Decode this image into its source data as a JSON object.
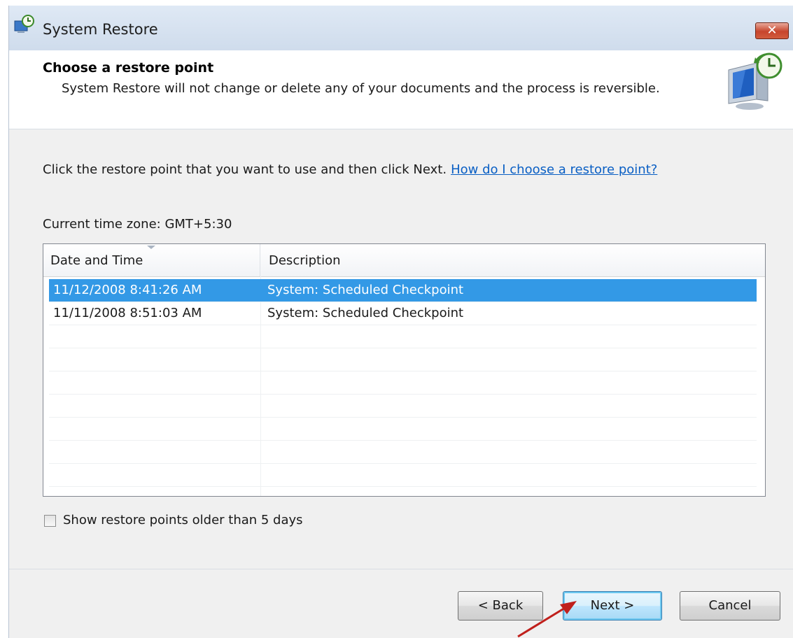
{
  "window": {
    "title": "System Restore",
    "close_label": "✕"
  },
  "header": {
    "title": "Choose a restore point",
    "subtitle": "System Restore will not change or delete any of your documents and the process is reversible."
  },
  "main": {
    "instruction": "Click the restore point that you want to use and then click Next.",
    "help_link": "How do I choose a restore point?",
    "timezone": "Current time zone: GMT+5:30",
    "list": {
      "columns": [
        "Date and Time",
        "Description"
      ],
      "rows": [
        {
          "date": "11/12/2008 8:41:26 AM",
          "description": "System: Scheduled Checkpoint",
          "selected": true
        },
        {
          "date": "11/11/2008 8:51:03 AM",
          "description": "System: Scheduled Checkpoint",
          "selected": false
        }
      ]
    },
    "show_older_label": "Show restore points older than 5 days",
    "show_older_checked": false
  },
  "footer": {
    "back_label": "< Back",
    "next_label": "Next >",
    "cancel_label": "Cancel"
  },
  "icons": {
    "app": "system-restore-icon",
    "header": "system-restore-computer-icon",
    "annotation": "red-arrow-icon"
  },
  "colors": {
    "selection": "#3399e6",
    "link": "#0a5fc4",
    "annotation_arrow": "#c0201c"
  }
}
